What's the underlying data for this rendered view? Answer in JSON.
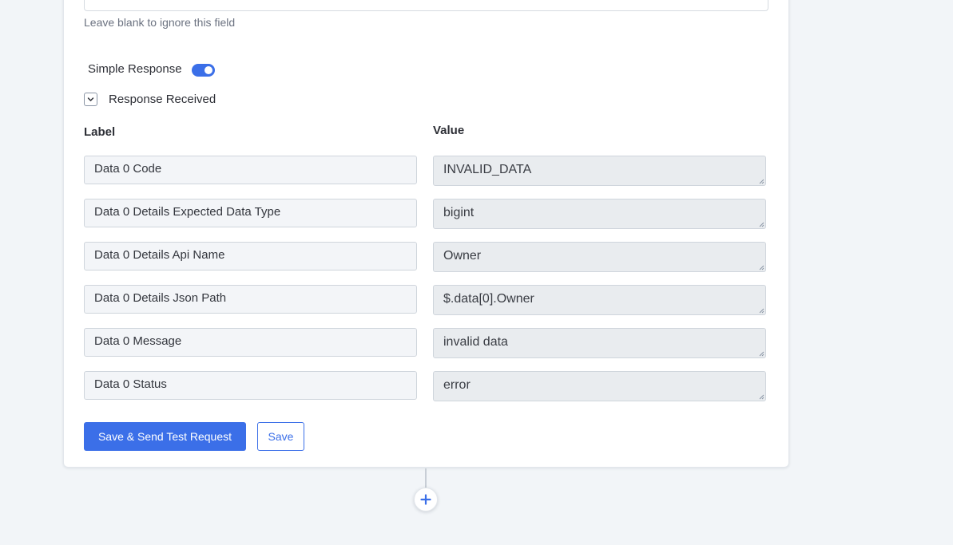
{
  "form": {
    "helper_text": "Leave blank to ignore this field",
    "simple_response_label": "Simple Response",
    "simple_response_on": true,
    "response_received_label": "Response Received",
    "columns": {
      "label": "Label",
      "value": "Value"
    },
    "rows": [
      {
        "label": "Data 0 Code",
        "value": "INVALID_DATA"
      },
      {
        "label": "Data 0 Details Expected Data Type",
        "value": "bigint"
      },
      {
        "label": "Data 0 Details Api Name",
        "value": "Owner"
      },
      {
        "label": "Data 0 Details Json Path",
        "value": "$.data[0].Owner"
      },
      {
        "label": "Data 0 Message",
        "value": "invalid data"
      },
      {
        "label": "Data 0 Status",
        "value": "error"
      }
    ],
    "save_send_label": "Save & Send Test Request",
    "save_label": "Save"
  },
  "icons": {
    "expand": "chevron-down-icon",
    "add_step": "plus-icon",
    "resize": "resize-grip-icon"
  },
  "colors": {
    "accent": "#3b6fe8",
    "background": "#f2f5f8"
  }
}
